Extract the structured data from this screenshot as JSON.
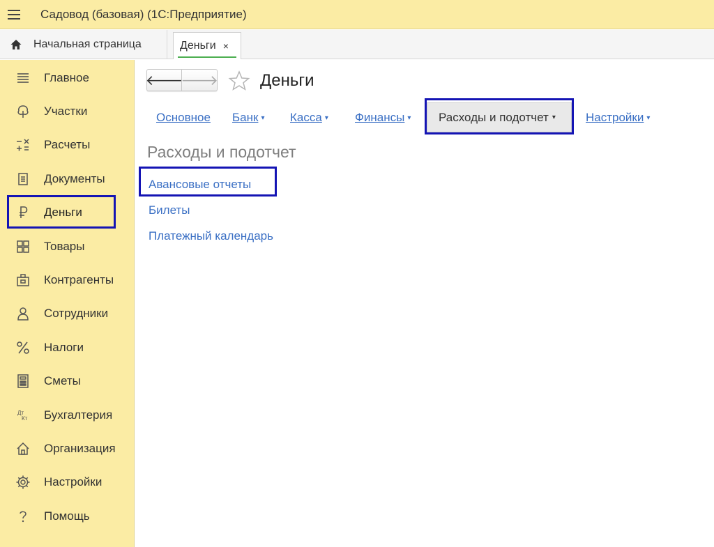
{
  "app": {
    "title": "Садовод (базовая)  (1С:Предприятие)"
  },
  "tabs": {
    "home_label": "Начальная страница",
    "active_label": "Деньги",
    "close_glyph": "×"
  },
  "sidebar": {
    "items": [
      {
        "label": "Главное",
        "icon": "menu-lines-icon"
      },
      {
        "label": "Участки",
        "icon": "tree-icon"
      },
      {
        "label": "Расчеты",
        "icon": "calc-signs-icon"
      },
      {
        "label": "Документы",
        "icon": "document-icon"
      },
      {
        "label": "Деньги",
        "icon": "ruble-icon",
        "selected": true
      },
      {
        "label": "Товары",
        "icon": "goods-grid-icon"
      },
      {
        "label": "Контрагенты",
        "icon": "briefcase-icon"
      },
      {
        "label": "Сотрудники",
        "icon": "person-icon"
      },
      {
        "label": "Налоги",
        "icon": "percent-icon"
      },
      {
        "label": "Сметы",
        "icon": "calculator-icon"
      },
      {
        "label": "Бухгалтерия",
        "icon": "dt-kt-icon"
      },
      {
        "label": "Организация",
        "icon": "house-icon"
      },
      {
        "label": "Настройки",
        "icon": "gear-icon"
      },
      {
        "label": "Помощь",
        "icon": "question-icon"
      }
    ]
  },
  "main": {
    "title": "Деньги",
    "nav": {
      "back_glyph": "🡐",
      "forward_glyph": "🡒"
    },
    "menu": {
      "items": [
        "Основное",
        "Банк",
        "Касса",
        "Финансы",
        "Расходы и подотчет",
        "Настройки"
      ],
      "active": "Расходы и подотчет",
      "caret": "▾"
    },
    "section_title": "Расходы и подотчет",
    "links": [
      "Авансовые отчеты",
      "Билеты",
      "Платежный календарь"
    ]
  },
  "colors": {
    "panel_yellow": "#fbeca4",
    "link_blue": "#3a6fc4",
    "highlight_blue": "#1414b4",
    "active_tab_green": "#4caf50"
  }
}
